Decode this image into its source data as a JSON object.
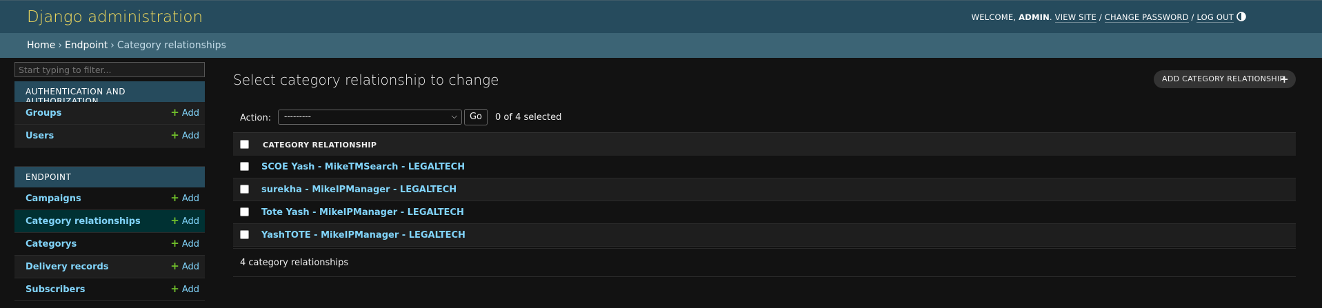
{
  "header": {
    "branding": "Django administration",
    "welcome": "Welcome,",
    "username": "admin",
    "view_site": "View site",
    "change_password": "Change password",
    "log_out": "Log out",
    "sep": "/"
  },
  "breadcrumbs": {
    "home": "Home",
    "app": "Endpoint",
    "current": "Category relationships",
    "sep": "›"
  },
  "sidebar": {
    "filter_placeholder": "Start typing to filter...",
    "modules": [
      {
        "caption": "Authentication and Authorization",
        "items": [
          {
            "label": "Groups",
            "add": "Add"
          },
          {
            "label": "Users",
            "add": "Add"
          }
        ]
      },
      {
        "caption": "Endpoint",
        "items": [
          {
            "label": "Campaigns",
            "add": "Add"
          },
          {
            "label": "Category relationships",
            "add": "Add",
            "current": true
          },
          {
            "label": "Categorys",
            "add": "Add"
          },
          {
            "label": "Delivery records",
            "add": "Add"
          },
          {
            "label": "Subscribers",
            "add": "Add"
          }
        ]
      }
    ]
  },
  "content": {
    "title": "Select category relationship to change",
    "add_button": "Add category relationship",
    "actions": {
      "label": "Action:",
      "selected_option": "---------",
      "go": "Go",
      "selected_count": "0 of 4 selected"
    },
    "table": {
      "column": "Category relationship",
      "rows": [
        "SCOE Yash - MikeTMSearch - LEGALTECH",
        "surekha - MikeIPManager - LEGALTECH",
        "Tote Yash - MikeIPManager - LEGALTECH",
        "YashTOTE - MikeIPManager - LEGALTECH"
      ]
    },
    "paginator": "4 category relationships"
  },
  "colors": {
    "header_bg": "#264b5d",
    "branding": "#f5dd5d",
    "link": "#81d4fa",
    "add_plus": "#70bf2b",
    "current_row": "#003133"
  }
}
